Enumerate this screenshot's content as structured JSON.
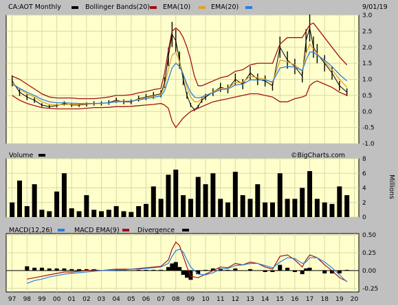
{
  "header": {
    "symbol": "CA:AOT Monthly",
    "date": "9/01/19",
    "watermark": "©BigCharts.com"
  },
  "colors": {
    "panel_bg": "#ffffcc",
    "frame_bg": "#c0c0c0",
    "price": "#000000",
    "bollinger": "#a01010",
    "ema10": "#e0a020",
    "ema20": "#2a7de1",
    "volume": "#000000",
    "macd": "#000000",
    "macd_ema": "#2a7de1",
    "divergence": "#000000"
  },
  "chart_data": [
    {
      "type": "line",
      "title": "CA:AOT Monthly",
      "legend": [
        {
          "label": "Bollinger Bands(20)",
          "swatch": "#a01010"
        },
        {
          "label": "EMA(10)",
          "swatch": "#e0a020"
        },
        {
          "label": "EMA(20)",
          "swatch": "#2a7de1"
        }
      ],
      "x_ticks": [
        "97",
        "98",
        "99",
        "00",
        "01",
        "02",
        "03",
        "04",
        "05",
        "06",
        "07",
        "08",
        "09",
        "10",
        "11",
        "12",
        "13",
        "14",
        "15",
        "16",
        "17",
        "18",
        "19",
        "20"
      ],
      "y_ticks": [
        "-1.0",
        "-0.5",
        "0.0",
        "0.5",
        "1.0",
        "1.5",
        "2.0",
        "2.5",
        "3.0"
      ],
      "ylim": [
        -1.0,
        3.0
      ],
      "x": [
        1997.0,
        1997.5,
        1998.0,
        1998.5,
        1999.0,
        1999.5,
        2000.0,
        2000.5,
        2001.0,
        2001.5,
        2002.0,
        2002.5,
        2003.0,
        2003.5,
        2004.0,
        2004.5,
        2005.0,
        2005.5,
        2006.0,
        2006.5,
        2007.0,
        2007.25,
        2007.5,
        2007.75,
        2008.0,
        2008.25,
        2008.5,
        2008.75,
        2009.0,
        2009.25,
        2009.5,
        2009.75,
        2010.0,
        2010.5,
        2011.0,
        2011.5,
        2012.0,
        2012.5,
        2013.0,
        2013.5,
        2014.0,
        2014.5,
        2015.0,
        2015.5,
        2016.0,
        2016.5,
        2016.75,
        2017.0,
        2017.25,
        2017.5,
        2018.0,
        2018.5,
        2019.0,
        2019.5
      ],
      "series": [
        {
          "name": "CA:AOT Monthly",
          "values": [
            0.95,
            0.6,
            0.45,
            0.35,
            0.2,
            0.15,
            0.18,
            0.25,
            0.2,
            0.2,
            0.22,
            0.25,
            0.25,
            0.28,
            0.35,
            0.3,
            0.3,
            0.4,
            0.45,
            0.5,
            0.55,
            0.9,
            1.7,
            2.4,
            2.2,
            1.6,
            1.0,
            0.5,
            0.2,
            0.05,
            0.15,
            0.35,
            0.45,
            0.6,
            0.75,
            0.7,
            1.0,
            0.85,
            1.2,
            1.0,
            0.95,
            0.8,
            2.0,
            1.6,
            1.4,
            1.1,
            2.2,
            2.6,
            2.0,
            1.8,
            1.5,
            1.2,
            0.8,
            0.6
          ]
        },
        {
          "name": "EMA(10)",
          "values": [
            0.9,
            0.7,
            0.55,
            0.45,
            0.3,
            0.22,
            0.2,
            0.22,
            0.22,
            0.22,
            0.23,
            0.24,
            0.25,
            0.27,
            0.32,
            0.32,
            0.32,
            0.38,
            0.43,
            0.48,
            0.53,
            0.8,
            1.3,
            1.75,
            1.85,
            1.55,
            1.15,
            0.75,
            0.45,
            0.3,
            0.3,
            0.4,
            0.5,
            0.6,
            0.72,
            0.72,
            0.9,
            0.9,
            1.1,
            1.05,
            1.0,
            0.9,
            1.6,
            1.55,
            1.45,
            1.25,
            1.8,
            2.1,
            1.95,
            1.8,
            1.55,
            1.3,
            1.0,
            0.75
          ]
        },
        {
          "name": "EMA(20)",
          "values": [
            0.85,
            0.72,
            0.6,
            0.5,
            0.38,
            0.3,
            0.27,
            0.27,
            0.26,
            0.25,
            0.25,
            0.25,
            0.26,
            0.27,
            0.3,
            0.31,
            0.32,
            0.36,
            0.4,
            0.44,
            0.48,
            0.65,
            1.0,
            1.35,
            1.5,
            1.4,
            1.15,
            0.85,
            0.6,
            0.45,
            0.42,
            0.45,
            0.5,
            0.58,
            0.68,
            0.7,
            0.82,
            0.85,
            0.98,
            0.98,
            0.98,
            0.92,
            1.35,
            1.4,
            1.38,
            1.28,
            1.6,
            1.85,
            1.85,
            1.75,
            1.6,
            1.4,
            1.15,
            0.95
          ]
        },
        {
          "name": "Bollinger Bands(20) upper",
          "values": [
            1.1,
            1.0,
            0.85,
            0.7,
            0.55,
            0.45,
            0.42,
            0.42,
            0.42,
            0.4,
            0.4,
            0.4,
            0.42,
            0.45,
            0.5,
            0.5,
            0.52,
            0.58,
            0.62,
            0.68,
            0.72,
            1.2,
            1.9,
            2.5,
            2.6,
            2.5,
            2.3,
            2.0,
            1.6,
            1.1,
            0.8,
            0.8,
            0.85,
            0.95,
            1.05,
            1.1,
            1.25,
            1.3,
            1.45,
            1.5,
            1.5,
            1.5,
            2.1,
            2.3,
            2.3,
            2.3,
            2.5,
            2.7,
            2.75,
            2.6,
            2.3,
            2.0,
            1.7,
            1.45
          ]
        },
        {
          "name": "Bollinger Bands(20) lower",
          "values": [
            0.5,
            0.35,
            0.25,
            0.18,
            0.12,
            0.1,
            0.08,
            0.08,
            0.08,
            0.08,
            0.1,
            0.12,
            0.12,
            0.13,
            0.15,
            0.15,
            0.16,
            0.18,
            0.2,
            0.22,
            0.25,
            0.2,
            0.1,
            -0.3,
            -0.5,
            -0.35,
            -0.2,
            -0.1,
            0.0,
            0.05,
            0.1,
            0.15,
            0.2,
            0.3,
            0.35,
            0.4,
            0.45,
            0.5,
            0.55,
            0.55,
            0.5,
            0.45,
            0.3,
            0.3,
            0.4,
            0.45,
            0.5,
            0.8,
            0.9,
            0.95,
            0.85,
            0.75,
            0.6,
            0.5
          ]
        }
      ]
    },
    {
      "type": "bar",
      "title": "Volume",
      "ylabel": "Millions",
      "y_ticks": [
        "0",
        "2",
        "4",
        "6",
        "8"
      ],
      "ylim": [
        0,
        8
      ],
      "x_ticks": [
        "97",
        "98",
        "99",
        "00",
        "01",
        "02",
        "03",
        "04",
        "05",
        "06",
        "07",
        "08",
        "09",
        "10",
        "11",
        "12",
        "13",
        "14",
        "15",
        "16",
        "17",
        "18",
        "19",
        "20"
      ],
      "x": [
        1997.0,
        1997.5,
        1998.0,
        1998.5,
        1999.0,
        1999.5,
        2000.0,
        2000.5,
        2001.0,
        2001.5,
        2002.0,
        2002.5,
        2003.0,
        2003.5,
        2004.0,
        2004.5,
        2005.0,
        2005.5,
        2006.0,
        2006.5,
        2007.0,
        2007.5,
        2008.0,
        2008.5,
        2009.0,
        2009.5,
        2010.0,
        2010.5,
        2011.0,
        2011.5,
        2012.0,
        2012.5,
        2013.0,
        2013.5,
        2014.0,
        2014.5,
        2015.0,
        2015.5,
        2016.0,
        2016.5,
        2017.0,
        2017.5,
        2018.0,
        2018.5,
        2019.0,
        2019.5
      ],
      "values": [
        2.0,
        5.0,
        1.5,
        4.5,
        1.0,
        0.8,
        3.5,
        6.0,
        1.2,
        0.8,
        3.0,
        1.0,
        0.8,
        1.0,
        1.5,
        0.8,
        0.7,
        1.5,
        1.8,
        4.2,
        2.5,
        5.8,
        6.5,
        3.0,
        2.5,
        5.5,
        4.5,
        6.0,
        2.5,
        2.0,
        6.2,
        3.0,
        2.5,
        4.5,
        2.0,
        2.0,
        6.0,
        2.5,
        2.5,
        4.0,
        6.3,
        2.5,
        2.0,
        1.8,
        4.2,
        3.0
      ]
    },
    {
      "type": "line",
      "title": "MACD",
      "legend": [
        {
          "label": "MACD(12,26)",
          "swatch": "#000000"
        },
        {
          "label": "MACD EMA(9)",
          "swatch": "#2a7de1"
        },
        {
          "label": "Divergence",
          "swatch": "#000000"
        }
      ],
      "y_ticks": [
        "-0.25",
        "0.00",
        "0.25",
        "0.50"
      ],
      "ylim": [
        -0.3,
        0.52
      ],
      "x_ticks": [
        "97",
        "98",
        "99",
        "00",
        "01",
        "02",
        "03",
        "04",
        "05",
        "06",
        "07",
        "08",
        "09",
        "10",
        "11",
        "12",
        "13",
        "14",
        "15",
        "16",
        "17",
        "18",
        "19",
        "20"
      ],
      "x": [
        1998.0,
        1998.5,
        1999.0,
        1999.5,
        2000.0,
        2000.5,
        2001.0,
        2001.5,
        2002.0,
        2002.5,
        2003.0,
        2003.5,
        2004.0,
        2004.5,
        2005.0,
        2005.5,
        2006.0,
        2006.5,
        2007.0,
        2007.5,
        2007.75,
        2008.0,
        2008.25,
        2008.5,
        2008.75,
        2009.0,
        2009.5,
        2010.0,
        2010.5,
        2011.0,
        2011.5,
        2012.0,
        2012.5,
        2013.0,
        2013.5,
        2014.0,
        2014.5,
        2015.0,
        2015.5,
        2016.0,
        2016.5,
        2016.75,
        2017.0,
        2017.5,
        2018.0,
        2018.5,
        2019.0,
        2019.5
      ],
      "series": [
        {
          "name": "MACD(12,26)",
          "values": [
            -0.12,
            -0.1,
            -0.08,
            -0.06,
            -0.04,
            -0.02,
            -0.02,
            -0.01,
            0.0,
            0.01,
            0.0,
            0.01,
            0.02,
            0.02,
            0.02,
            0.03,
            0.04,
            0.05,
            0.06,
            0.15,
            0.3,
            0.4,
            0.35,
            0.2,
            0.05,
            -0.08,
            -0.1,
            -0.05,
            0.0,
            0.05,
            0.04,
            0.1,
            0.08,
            0.12,
            0.1,
            0.05,
            0.02,
            0.2,
            0.22,
            0.15,
            0.05,
            0.15,
            0.22,
            0.18,
            0.08,
            0.0,
            -0.1,
            -0.15
          ]
        },
        {
          "name": "MACD EMA(9)",
          "values": [
            -0.18,
            -0.14,
            -0.12,
            -0.09,
            -0.07,
            -0.05,
            -0.04,
            -0.03,
            -0.02,
            -0.01,
            0.0,
            0.0,
            0.01,
            0.01,
            0.02,
            0.02,
            0.03,
            0.04,
            0.05,
            0.1,
            0.2,
            0.28,
            0.3,
            0.26,
            0.15,
            0.05,
            -0.05,
            -0.06,
            -0.03,
            0.02,
            0.03,
            0.07,
            0.08,
            0.1,
            0.1,
            0.07,
            0.04,
            0.12,
            0.18,
            0.17,
            0.1,
            0.12,
            0.18,
            0.18,
            0.12,
            0.04,
            -0.06,
            -0.16
          ]
        }
      ],
      "divergence": [
        0.06,
        0.04,
        0.04,
        0.03,
        0.03,
        0.03,
        0.02,
        0.02,
        0.02,
        0.02,
        0.0,
        0.01,
        0.01,
        0.01,
        0.0,
        0.01,
        0.01,
        0.01,
        0.01,
        0.05,
        0.1,
        0.12,
        0.05,
        -0.06,
        -0.1,
        -0.13,
        -0.05,
        0.01,
        0.03,
        0.03,
        0.01,
        0.03,
        0.0,
        0.02,
        0.0,
        -0.02,
        -0.02,
        0.08,
        0.04,
        -0.02,
        -0.05,
        0.03,
        0.04,
        0.0,
        -0.04,
        -0.04,
        -0.04,
        0.01
      ]
    }
  ]
}
